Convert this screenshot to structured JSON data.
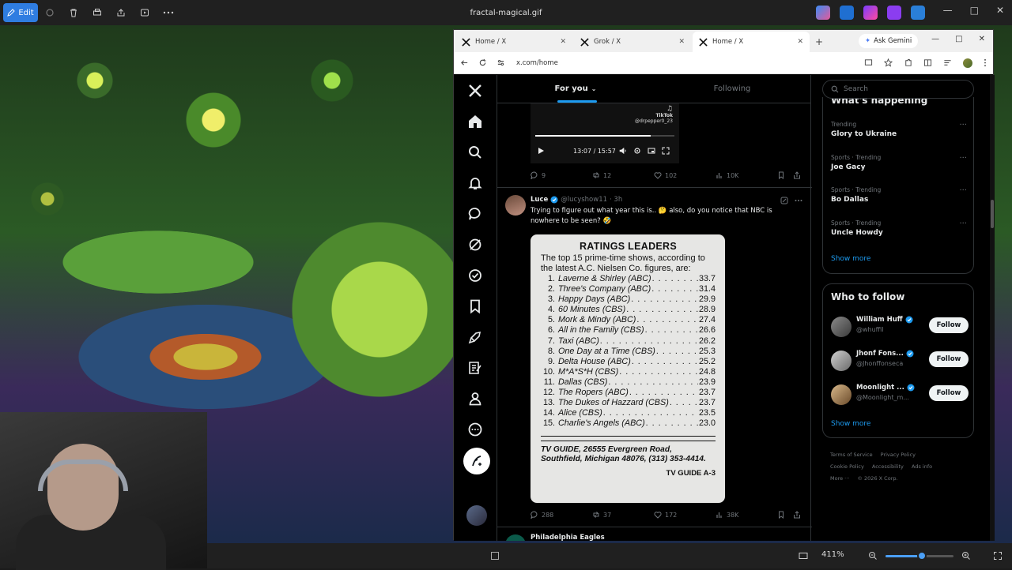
{
  "viewer": {
    "edit_label": "Edit",
    "title": "fractal-magical.gif",
    "zoom": "411%",
    "zoom_level": 0.53
  },
  "browser": {
    "tabs": [
      {
        "label": "Home / X"
      },
      {
        "label": "Grok / X"
      },
      {
        "label": "Home / X"
      }
    ],
    "active_tab": 2,
    "ask_gemini": "Ask Gemini",
    "url": "x.com/home"
  },
  "feed": {
    "tab_for_you": "For you",
    "tab_following": "Following",
    "video": {
      "tiktok": "TikTok",
      "tiktok_handle": "@drpepper0_23",
      "time": "13:07 / 15:57",
      "progress": 0.83
    },
    "prev_actions": {
      "replies": "9",
      "reposts": "12",
      "likes": "102",
      "views": "10K"
    },
    "post": {
      "name": "Luce",
      "handle": "@lucyshow11",
      "time": "· 3h",
      "text": "Trying to figure out what year this is.. 🤔 also, do you notice that NBC is nowhere to be seen? 🤣",
      "actions": {
        "replies": "288",
        "reposts": "37",
        "likes": "172",
        "views": "38K"
      }
    },
    "ratings_card": {
      "title": "RATINGS LEADERS",
      "intro": "The top 15 prime-time shows, according to the latest A.C. Nielsen Co. figures, are:",
      "rows": [
        {
          "rank": "1.",
          "show": "Laverne & Shirley (ABC)",
          "score": "33.7"
        },
        {
          "rank": "2.",
          "show": "Three's Company (ABC)",
          "score": "31.4"
        },
        {
          "rank": "3.",
          "show": "Happy Days (ABC)",
          "score": "29.9"
        },
        {
          "rank": "4.",
          "show": "60 Minutes (CBS)",
          "score": "28.9"
        },
        {
          "rank": "5.",
          "show": "Mork & Mindy (ABC)",
          "score": "27.4"
        },
        {
          "rank": "6.",
          "show": "All in the Family (CBS)",
          "score": "26.6"
        },
        {
          "rank": "7.",
          "show": "Taxi (ABC)",
          "score": "26.2"
        },
        {
          "rank": "8.",
          "show": "One Day at a Time (CBS)",
          "score": "25.3"
        },
        {
          "rank": "9.",
          "show": "Delta House (ABC)",
          "score": "25.2"
        },
        {
          "rank": "10.",
          "show": "M*A*S*H (CBS)",
          "score": "24.8"
        },
        {
          "rank": "11.",
          "show": "Dallas (CBS)",
          "score": "23.9"
        },
        {
          "rank": "12.",
          "show": "The Ropers (ABC)",
          "score": "23.7"
        },
        {
          "rank": "13.",
          "show": "The Dukes of Hazzard (CBS)",
          "score": "23.7"
        },
        {
          "rank": "14.",
          "show": "Alice (CBS)",
          "score": "23.5"
        },
        {
          "rank": "15.",
          "show": "Charlie's Angels (ABC)",
          "score": "23.0"
        }
      ],
      "address": "TV GUIDE, 26555 Evergreen Road, Southfield, Michigan 48076, (313) 353-4414.",
      "page": "TV GUIDE A-3"
    },
    "next_post_name": "Philadelphia Eagles"
  },
  "sidebar": {
    "search_placeholder": "Search",
    "happening_title": "What's happening",
    "trends": [
      {
        "meta": "Trending",
        "name": "Glory to Ukraine"
      },
      {
        "meta": "Sports · Trending",
        "name": "Joe Gacy"
      },
      {
        "meta": "Sports · Trending",
        "name": "Bo Dallas"
      },
      {
        "meta": "Sports · Trending",
        "name": "Uncle Howdy"
      }
    ],
    "show_more": "Show more",
    "who_to_follow": "Who to follow",
    "follow_label": "Follow",
    "suggestions": [
      {
        "name": "William Huff",
        "handle": "@whuffil"
      },
      {
        "name": "Jhonf Fons...",
        "handle": "@Jhonffonseca"
      },
      {
        "name": "Moonlight ...",
        "handle": "@Moonlight_m..."
      }
    ],
    "footer": [
      "Terms of Service",
      "Privacy Policy",
      "Cookie Policy",
      "Accessibility",
      "Ads info",
      "More ···",
      "© 2026 X Corp."
    ]
  },
  "colors": {
    "accent": "#1d9bf0",
    "viewer_accent": "#2f7de1"
  }
}
